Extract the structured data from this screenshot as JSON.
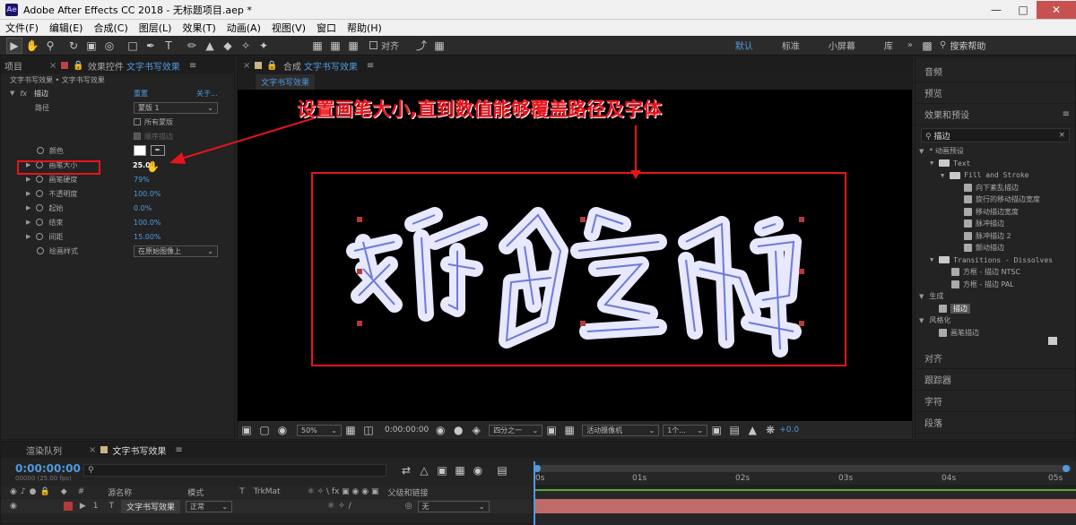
{
  "window": {
    "title": "Adobe After Effects CC 2018 - 无标题项目.aep *",
    "logo": "Ae"
  },
  "menu": [
    "文件(F)",
    "编辑(E)",
    "合成(C)",
    "图层(L)",
    "效果(T)",
    "动画(A)",
    "视图(V)",
    "窗口",
    "帮助(H)"
  ],
  "toolbar": {
    "align_label": "对齐",
    "workspaces": [
      {
        "label": "默认",
        "active": true
      },
      {
        "label": "标准",
        "active": false
      },
      {
        "label": "小屏幕",
        "active": false
      },
      {
        "label": "库",
        "active": false
      }
    ],
    "search_placeholder": "搜索帮助"
  },
  "left_panel": {
    "tab_project": "项目",
    "tab_effects": "效果控件",
    "tab_effects_name": "文字书写效果",
    "breadcrumb": "文字书写效果 • 文字书写效果",
    "effect_name": "描边",
    "reset_label": "重置",
    "about_label": "关于...",
    "path_label": "路径",
    "path_value": "蒙版 1",
    "all_masks_label": "所有蒙版",
    "seq_stroke_label": "顺序描边",
    "properties": [
      {
        "label": "颜色",
        "value": ""
      },
      {
        "label": "画笔大小",
        "value": "25.0"
      },
      {
        "label": "画笔硬度",
        "value": "79%"
      },
      {
        "label": "不透明度",
        "value": "100.0%"
      },
      {
        "label": "起始",
        "value": "0.0%"
      },
      {
        "label": "结束",
        "value": "100.0%"
      },
      {
        "label": "间距",
        "value": "15.00%"
      },
      {
        "label": "绘画样式",
        "value": "在原始图像上"
      }
    ]
  },
  "comp_panel": {
    "tab_label": "合成",
    "tab_name": "文字书写效果",
    "sub_tab": "文字书写效果",
    "annotation": "设置画笔大小,直到数值能够覆盖路径及字体",
    "footer": {
      "zoom": "50%",
      "timecode": "0:00:00:00",
      "resolution": "四分之一",
      "camera": "活动摄像机",
      "views": "1个...",
      "exposure": "+0.0"
    }
  },
  "right_panel": {
    "items_top": [
      "音频",
      "预览"
    ],
    "effects_title": "效果和预设",
    "search_value": "描边",
    "tree": [
      {
        "label": "* 动画预设",
        "level": 0,
        "kind": "arrow"
      },
      {
        "label": "Text",
        "level": 1,
        "kind": "folder"
      },
      {
        "label": "Fill and Stroke",
        "level": 2,
        "kind": "folder"
      },
      {
        "label": "向下紊乱描边",
        "level": 3,
        "kind": "fx"
      },
      {
        "label": "旋行的移动描边宽度",
        "level": 3,
        "kind": "fx"
      },
      {
        "label": "移动描边宽度",
        "level": 3,
        "kind": "fx"
      },
      {
        "label": "脉冲描边",
        "level": 3,
        "kind": "fx"
      },
      {
        "label": "脉冲描边 2",
        "level": 3,
        "kind": "fx"
      },
      {
        "label": "颤动描边",
        "level": 3,
        "kind": "fx"
      },
      {
        "label": "Transitions - Dissolves",
        "level": 1,
        "kind": "folder"
      },
      {
        "label": "方框 - 描边 NTSC",
        "level": 2,
        "kind": "fx"
      },
      {
        "label": "方框 - 描边 PAL",
        "level": 2,
        "kind": "fx"
      },
      {
        "label": "生成",
        "level": 0,
        "kind": "arrow"
      },
      {
        "label": "描边",
        "level": 1,
        "kind": "fx",
        "selected": true
      },
      {
        "label": "风格化",
        "level": 0,
        "kind": "arrow"
      },
      {
        "label": "画笔描边",
        "level": 1,
        "kind": "fx"
      }
    ],
    "items_bottom": [
      "对齐",
      "跟踪器",
      "字符",
      "段落"
    ]
  },
  "timeline": {
    "tab_render": "渲染队列",
    "tab_comp": "文字书写效果",
    "timecode": "0:00:00:00",
    "fps": "00000 (25.00 fps)",
    "col_source": "源名称",
    "col_mode": "模式",
    "col_t": "T",
    "col_trkmat": "TrkMat",
    "col_parent": "父级和链接",
    "layer": {
      "index": "1",
      "type": "T",
      "name": "文字书写效果",
      "mode": "正常",
      "parent": "无"
    },
    "ruler": [
      "0s",
      "01s",
      "02s",
      "03s",
      "04s",
      "05s"
    ]
  },
  "colors": {
    "accent": "#4f9ae0",
    "annotation": "#e8141c",
    "layer_bar": "#c06a6a",
    "path": "#6b7bd8"
  }
}
